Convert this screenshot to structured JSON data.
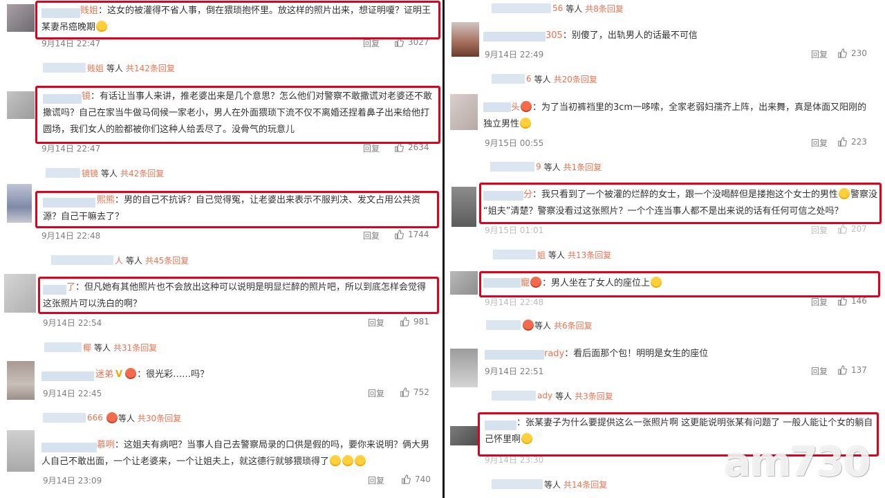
{
  "left": {
    "comments": [
      {
        "handle": "贱姐",
        "text_lines": [
          "：这女的被灌得不省人事，倒在猥琐抱怀里。放这样的照片出来，想证明嗄？证明王",
          "某妻吊癌晚期"
        ],
        "date": "9月14日 22:47",
        "reply": "回复",
        "likes": "3027",
        "sub": {
          "handle": "贱姐",
          "label": "等人",
          "count": "共142条回复"
        }
      },
      {
        "handle": "镜",
        "text_lines": [
          "：有话让当事人来讲，推老婆出来是几个意思？怎么他们对警察不敢撒谎对老婆还不敢",
          "撒谎吗？自己在家当牛做马伺候一家老小，男人在外面猥琐下流不仅不离婚还捏着鼻子出来给他打",
          "圆场，我们女人的脸都被你们这种人给丢尽了。没骨气的玩意儿"
        ],
        "date": "9月14日 22:47",
        "reply": "回复",
        "likes": "2634",
        "sub": {
          "handle": "镜镜",
          "label": "等人",
          "count": "共42条回复"
        }
      },
      {
        "handle": "熙熊",
        "text_lines": [
          "：男的自己不抗诉？自己觉得冤，让老婆出来表示不服判决、发文占用公共资",
          "源？自己干嘛去了？"
        ],
        "date": "9月14日 22:48",
        "reply": "回复",
        "likes": "1744",
        "sub": {
          "handle": "人",
          "label": "等人",
          "count": "共45条回复"
        }
      },
      {
        "handle": "了",
        "text_lines": [
          "：但凡她有其他照片也不会放出这种可以说明是明显烂醉的照片吧，所以到底怎样会觉得",
          "这张照片可以洗白的啊？"
        ],
        "date": "9月14日 22:54",
        "reply": "回复",
        "likes": "981",
        "sub": {
          "handle": "椰",
          "label": "等人",
          "count": "共31条回复"
        }
      },
      {
        "handle": "迷弟",
        "text_lines": [
          "：很光彩……吗？"
        ],
        "date": "9月14日 22:45",
        "reply": "回复",
        "likes": "752",
        "sub": {
          "handle": "666",
          "label": "等人",
          "count": "共30条回复"
        }
      },
      {
        "handle": "慕咧",
        "text_lines": [
          "：这姐夫有病吧？当事人自己去警察局录的口供是假的吗，要你来说明？俩大男",
          "人自己不敢出面，一个让老婆来，一个让姐夫上，就这德行就够猥琐得了"
        ],
        "date": "9月14日 23:09",
        "reply": "回复",
        "likes": "740"
      }
    ]
  },
  "right": {
    "top_sub": {
      "handle": "56",
      "label": "等人",
      "count": "共8条回复"
    },
    "comments": [
      {
        "handle": "305",
        "text_lines": [
          "：别傻了，出轨男人的话最不可信"
        ],
        "date": "9月14日 22:49",
        "reply": "回复",
        "likes": "230",
        "sub": {
          "handle": "6",
          "label": "等人",
          "count": "共20条回复"
        }
      },
      {
        "handle": "头",
        "text_lines": [
          "：为了当初裤裆里的3cm一哆嗦，全家老弱妇孺齐上阵，出来舞，真是体面又阳刚的",
          "独立男性"
        ],
        "date": "9月15日 00:55",
        "reply": "回复",
        "likes": "223",
        "sub": {
          "handle": "9",
          "label": "等人",
          "count": "共1条回复"
        }
      },
      {
        "handle": "分",
        "text_lines": [
          "：我只看到了一个被灌的烂醉的女士，跟一个没喝醉但是搂抱这个女士的男性",
          "“姐夫”清楚？警察没看过这张照片？一个个连当事人都不是出来说的话有任何可信之处吗？"
        ],
        "text_tail": "警察没",
        "date": "9月15日 01:01",
        "reply": "回复",
        "likes": "207",
        "sub": {
          "handle": "姐",
          "label": "等人",
          "count": "共13条回复"
        }
      },
      {
        "handle": "寵",
        "text_lines": [
          "：男人坐在了女人的座位上"
        ],
        "date": "9月14日 22:48",
        "reply": "回复",
        "likes": "146",
        "sub": {
          "handle": "",
          "label": "等人",
          "count": "共6条回复"
        }
      },
      {
        "handle": "rady",
        "text_lines": [
          "：看后面那个包！明明是女生的座位"
        ],
        "date": "9月14日 22:51",
        "reply": "回复",
        "likes": "137",
        "sub": {
          "handle": "ady",
          "label": "等人",
          "count": "共3条回复"
        }
      },
      {
        "handle": "",
        "text_lines": [
          "：张某妻子为什么要提供这么一张照片啊 这更能说明张某有问题了 一般人能让个女的躺自",
          "己怀里啊"
        ],
        "date": "9月14日 23:30",
        "reply": "回复",
        "likes": "",
        "sub": {
          "handle": "",
          "label": "等人",
          "count": "共14条回复"
        }
      }
    ]
  },
  "watermark": "am730",
  "colors": {
    "highlight": "#e0001b",
    "link": "#eb7350",
    "meta": "#808080",
    "text": "#333333"
  },
  "icons": {
    "like": "thumbs-up-icon",
    "emoji": "emoji-face-icon"
  }
}
